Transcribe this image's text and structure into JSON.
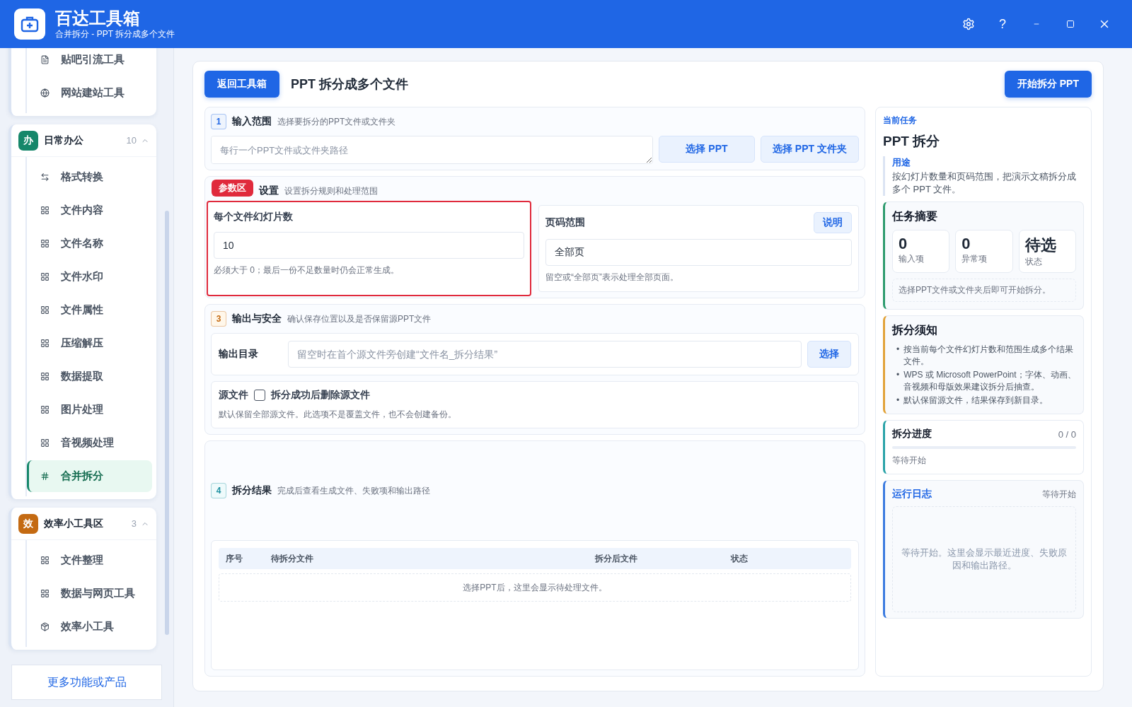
{
  "header": {
    "title": "百达工具箱",
    "subtitle": "合并拆分 - PPT 拆分成多个文件",
    "help": "?"
  },
  "sidebar": {
    "groups": [
      {
        "items": [
          {
            "label": "贴吧引流工具",
            "kind": "doc",
            "selected": false
          },
          {
            "label": "网站建站工具",
            "kind": "globe",
            "selected": false
          }
        ]
      },
      {
        "badge": "办",
        "color": "#16876a",
        "title": "日常办公",
        "count": "10",
        "expanded": true,
        "items": [
          {
            "label": "格式转换",
            "kind": "swap",
            "selected": false
          },
          {
            "label": "文件内容",
            "kind": "grid",
            "selected": false
          },
          {
            "label": "文件名称",
            "kind": "grid",
            "selected": false
          },
          {
            "label": "文件水印",
            "kind": "grid",
            "selected": false
          },
          {
            "label": "文件属性",
            "kind": "grid",
            "selected": false
          },
          {
            "label": "压缩解压",
            "kind": "grid",
            "selected": false
          },
          {
            "label": "数据提取",
            "kind": "grid",
            "selected": false
          },
          {
            "label": "图片处理",
            "kind": "grid",
            "selected": false
          },
          {
            "label": "音视频处理",
            "kind": "grid",
            "selected": false
          },
          {
            "label": "合并拆分",
            "kind": "hash",
            "selected": true
          }
        ]
      },
      {
        "badge": "效",
        "color": "#c46a12",
        "title": "效率小工具区",
        "count": "3",
        "expanded": true,
        "items": [
          {
            "label": "文件整理",
            "kind": "grid",
            "selected": false
          },
          {
            "label": "数据与网页工具",
            "kind": "grid",
            "selected": false
          },
          {
            "label": "效率小工具",
            "kind": "box",
            "selected": false
          }
        ]
      }
    ],
    "footer": "更多功能或产品"
  },
  "toolbar": {
    "back": "返回工具箱",
    "title": "PPT 拆分成多个文件",
    "start": "开始拆分 PPT"
  },
  "input": {
    "number": "1",
    "title": "输入范围",
    "hint": "选择要拆分的PPT文件或文件夹",
    "placeholder": "每行一个PPT文件或文件夹路径",
    "buttons": [
      "选择 PPT",
      "选择 PPT 文件夹"
    ]
  },
  "settings": {
    "badge": "参数区",
    "title": "设置",
    "hint": "设置拆分规则和处理范围",
    "slides": {
      "label": "每个文件幻灯片数",
      "value": "10",
      "help": "必须大于 0；最后一份不足数量时仍会正常生成。"
    },
    "range": {
      "label": "页码范围",
      "info": "说明",
      "value": "全部页",
      "help": "留空或“全部页”表示处理全部页面。"
    }
  },
  "output": {
    "number": "3",
    "title": "输出与安全",
    "hint": "确认保存位置以及是否保留源PPT文件",
    "dir_label": "输出目录",
    "dir_placeholder": "留空时在首个源文件旁创建“文件名_拆分结果”",
    "choose": "选择",
    "source_label": "源文件",
    "delete_label": "拆分成功后删除源文件",
    "delete_checked": false,
    "source_help": "默认保留全部源文件。此选项不是覆盖文件，也不会创建备份。"
  },
  "results": {
    "number": "4",
    "title": "拆分结果",
    "hint": "完成后查看生成文件、失败项和输出路径",
    "columns": [
      "序号",
      "待拆分文件",
      "拆分后文件",
      "状态"
    ],
    "empty": "选择PPT后，这里会显示待处理文件。"
  },
  "panel": {
    "eyebrow": "当前任务",
    "title": "PPT 拆分",
    "usage_label": "用途",
    "usage": "按幻灯片数量和页码范围，把演示文稿拆分成多个 PPT 文件。",
    "summary": {
      "title": "任务摘要",
      "stats": [
        {
          "value": "0",
          "label": "输入项"
        },
        {
          "value": "0",
          "label": "异常项"
        },
        {
          "value": "待选",
          "label": "状态"
        }
      ],
      "hint": "选择PPT文件或文件夹后即可开始拆分。"
    },
    "notice": {
      "title": "拆分须知",
      "marker": "•",
      "bullets": [
        "按当前每个文件幻灯片数和范围生成多个结果文件。",
        "WPS 或 Microsoft PowerPoint；字体、动画、音视频和母版效果建议拆分后抽查。",
        "默认保留源文件，结果保存到新目录。"
      ]
    },
    "progress": {
      "title": "拆分进度",
      "count": "0 / 0",
      "level": 0,
      "status": "等待开始"
    },
    "log": {
      "title": "运行日志",
      "status": "等待开始",
      "empty": "等待开始。这里会显示最近进度、失败原因和输出路径。"
    }
  }
}
